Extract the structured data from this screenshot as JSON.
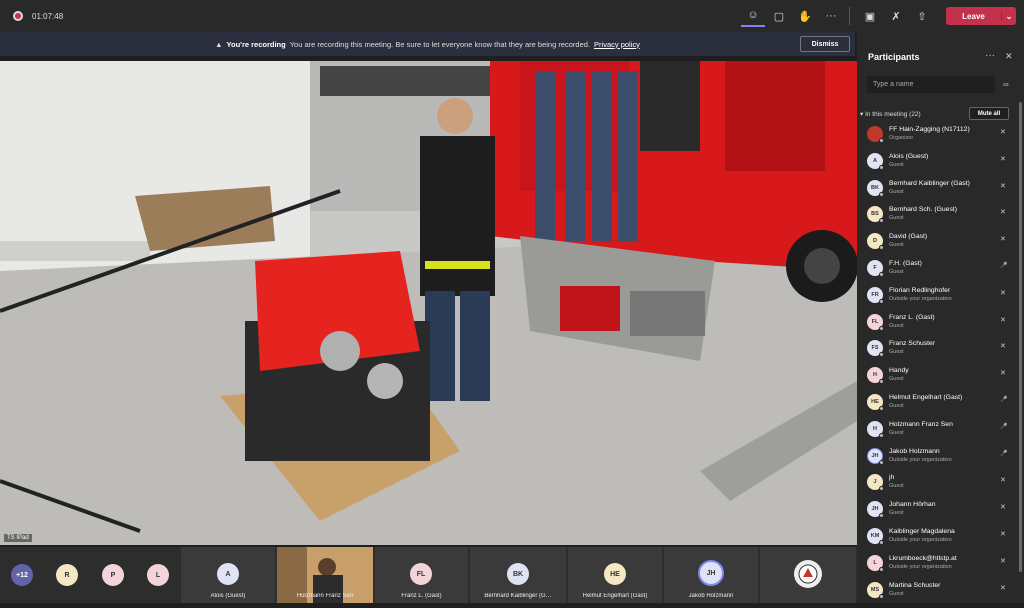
{
  "meeting": {
    "timer": "01:07:48"
  },
  "topbar": {
    "leave_label": "Leave",
    "icons": [
      "people-icon",
      "chat-icon",
      "raise-hand-icon",
      "more-icon",
      "camera-off-icon",
      "mic-off-icon",
      "share-icon"
    ]
  },
  "banner": {
    "title": "You're recording",
    "message": "You are recording this meeting. Be sure to let everyone know that they are being recorded.",
    "link": "Privacy policy",
    "dismiss": "Dismiss"
  },
  "video": {
    "label": "TS IPad"
  },
  "strip": {
    "overflow": "+12",
    "avatars": [
      {
        "initials": "R",
        "color": "#f5e6c4"
      },
      {
        "initials": "P",
        "color": "#f3d4d9"
      },
      {
        "initials": "L",
        "color": "#f3d4d9"
      }
    ],
    "tiles": [
      {
        "initials": "A",
        "name": "Alois (Guest)",
        "color": "#dfe3f3"
      },
      {
        "initials": "",
        "name": "Holzmann Franz Sen",
        "color": "#7a5b3b"
      },
      {
        "initials": "FL",
        "name": "Franz L. (Gast)",
        "color": "#f3d4d9"
      },
      {
        "initials": "BK",
        "name": "Bernhard Kaiblinger (G…",
        "color": "#dfe3f3"
      },
      {
        "initials": "HE",
        "name": "Helmut Engelhart (Gast)",
        "color": "#f5e6c4"
      },
      {
        "initials": "JH",
        "name": "Jakob Holzmann",
        "color": "#dfe3f3"
      },
      {
        "initials": "",
        "name": "",
        "color": "#555"
      }
    ]
  },
  "panel": {
    "title": "Participants",
    "search_placeholder": "Type a name",
    "section": "In this meeting (22)",
    "mute_all": "Mute all",
    "participants": [
      {
        "initials": "",
        "name": "FF Hain-Zagging (N17112)",
        "role": "Organizer",
        "color": "#c0392b",
        "mic": "on-off"
      },
      {
        "initials": "A",
        "name": "Alois (Guest)",
        "role": "Guest",
        "color": "#dfe3f3",
        "mic": "off"
      },
      {
        "initials": "BK",
        "name": "Bernhard Kaiblinger (Gast)",
        "role": "Guest",
        "color": "#dfe3f3",
        "mic": "off"
      },
      {
        "initials": "BS",
        "name": "Bernhard Sch. (Guest)",
        "role": "Guest",
        "color": "#f5e6c4",
        "mic": "off"
      },
      {
        "initials": "D",
        "name": "David (Gast)",
        "role": "Guest",
        "color": "#f5e6c4",
        "mic": "off"
      },
      {
        "initials": "F",
        "name": "F.H. (Gast)",
        "role": "Guest",
        "color": "#dfe3f3",
        "mic": "on"
      },
      {
        "initials": "FR",
        "name": "Florian Redlinghofer",
        "role": "Outside your organization",
        "color": "#dfe3f3",
        "mic": "off"
      },
      {
        "initials": "FL",
        "name": "Franz L. (Gast)",
        "role": "Guest",
        "color": "#f3d4d9",
        "mic": "off"
      },
      {
        "initials": "FS",
        "name": "Franz Schuster",
        "role": "Guest",
        "color": "#dfe3f3",
        "mic": "off"
      },
      {
        "initials": "H",
        "name": "Handy",
        "role": "Guest",
        "color": "#f3d4d9",
        "mic": "off"
      },
      {
        "initials": "HE",
        "name": "Helmut Engelhart (Gast)",
        "role": "Guest",
        "color": "#f5e6c4",
        "mic": "on"
      },
      {
        "initials": "H",
        "name": "Holzmann Franz Sen",
        "role": "Guest",
        "color": "#dfe3f3",
        "mic": "on"
      },
      {
        "initials": "JH",
        "name": "Jakob Holzmann",
        "role": "Outside your organization",
        "color": "#dfe3f3",
        "mic": "on"
      },
      {
        "initials": "J",
        "name": "jh",
        "role": "Guest",
        "color": "#f5e6c4",
        "mic": "off"
      },
      {
        "initials": "JH",
        "name": "Johann Hörhan",
        "role": "Guest",
        "color": "#dfe3f3",
        "mic": "off"
      },
      {
        "initials": "KM",
        "name": "Kaiblinger Magdalena",
        "role": "Outside your organization",
        "color": "#dfe3f3",
        "mic": "off"
      },
      {
        "initials": "L",
        "name": "Lkrumboeck@htlstp.at",
        "role": "Outside your organization",
        "color": "#f3d4d9",
        "mic": "off"
      },
      {
        "initials": "MS",
        "name": "Martina Schuster",
        "role": "Guest",
        "color": "#f5e6c4",
        "mic": "off"
      }
    ]
  }
}
